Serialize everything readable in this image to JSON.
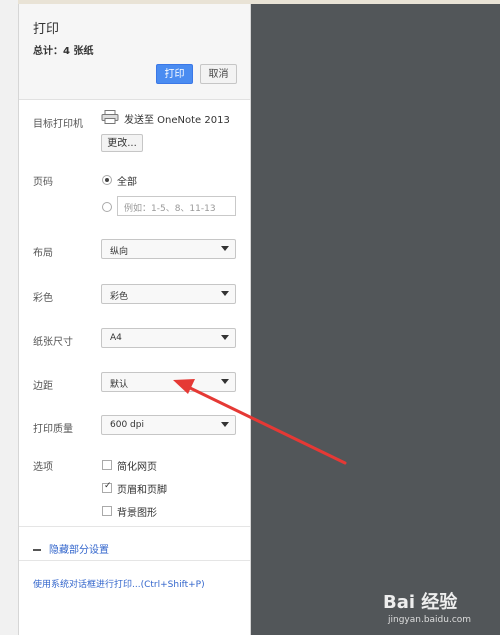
{
  "header": {
    "title": "打印",
    "summary": "总计：4 张纸"
  },
  "buttons": {
    "print": "打印",
    "cancel": "取消"
  },
  "destination": {
    "label": "目标打印机",
    "value": "发送至 OneNote 2013",
    "change": "更改..."
  },
  "pages": {
    "label": "页码",
    "all": "全部",
    "placeholder": "例如：1-5、8、11-13"
  },
  "layout": {
    "label": "布局",
    "value": "纵向"
  },
  "color": {
    "label": "彩色",
    "value": "彩色"
  },
  "paper_size": {
    "label": "纸张尺寸",
    "value": "A4"
  },
  "margins": {
    "label": "边距",
    "value": "默认"
  },
  "quality": {
    "label": "打印质量",
    "value": "600 dpi"
  },
  "options": {
    "label": "选项",
    "items": [
      {
        "label": "简化网页",
        "checked": false
      },
      {
        "label": "页眉和页脚",
        "checked": true
      },
      {
        "label": "背景图形",
        "checked": false
      }
    ]
  },
  "footer": {
    "less_settings": "隐藏部分设置",
    "system_dialog": "使用系统对话框进行打印...(Ctrl+Shift+P)"
  },
  "watermark": {
    "logo_text": "Bai 经验",
    "url": "jingyan.baidu.com"
  },
  "colors": {
    "accent": "#4a8cf1",
    "link": "#3366cc",
    "preview_bg": "#525659",
    "arrow": "#e53935"
  }
}
